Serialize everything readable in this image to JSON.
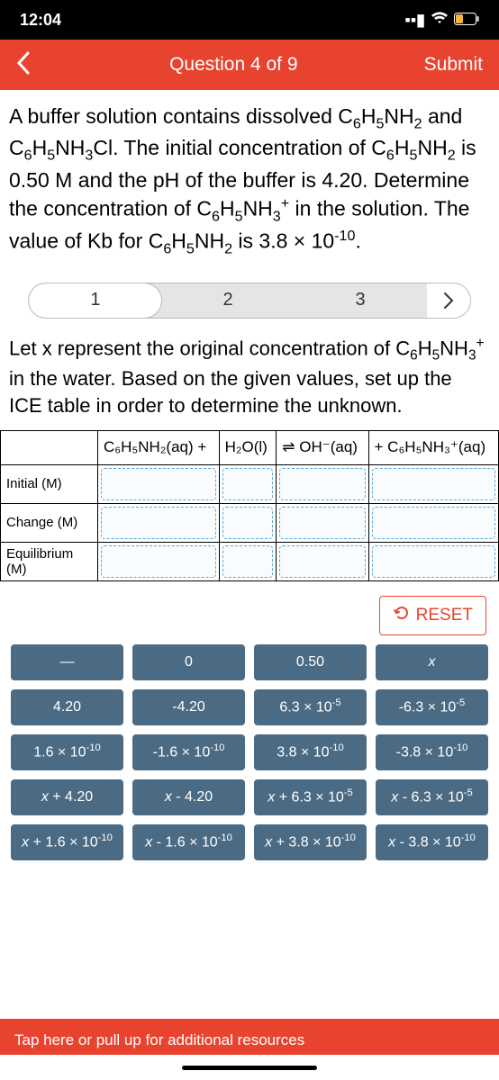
{
  "status": {
    "time": "12:04"
  },
  "header": {
    "title": "Question 4 of 9",
    "submit": "Submit"
  },
  "question_html": "A buffer solution contains dissolved C<sub>6</sub>H<sub>5</sub>NH<sub>2</sub> and C<sub>6</sub>H<sub>5</sub>NH<sub>3</sub>Cl. The initial concentration of C<sub>6</sub>H<sub>5</sub>NH<sub>2</sub> is 0.50 M and the pH of the buffer is 4.20. Determine the concentration of C<sub>6</sub>H<sub>5</sub>NH<sub>3</sub><sup>+</sup> in the solution. The value of Kb for C<sub>6</sub>H<sub>5</sub>NH<sub>2</sub> is 3.8 × 10<sup>-10</sup>.",
  "steps": {
    "s1": "1",
    "s2": "2",
    "s3": "3"
  },
  "instruction_html": "Let x represent the original concentration of C<sub>6</sub>H<sub>5</sub>NH<sub>3</sub><sup>+</sup> in the water. Based on the given values, set up the ICE table in order to determine the unknown.",
  "table": {
    "col1": "C₆H₅NH₂(aq)  +",
    "col2": "H₂O(l)",
    "col3": "⇌ OH⁻(aq)",
    "col4": "+ C₆H₅NH₃⁺(aq)",
    "r1": "Initial (M)",
    "r2": "Change (M)",
    "r3": "Equilibrium (M)"
  },
  "reset": "RESET",
  "options": [
    "—",
    "0",
    "0.50",
    "<i>x</i>",
    "4.20",
    "-4.20",
    "6.3 × 10<sup>-5</sup>",
    "-6.3 × 10<sup>-5</sup>",
    "1.6 × 10<sup>-10</sup>",
    "-1.6 × 10<sup>-10</sup>",
    "3.8 × 10<sup>-10</sup>",
    "-3.8 × 10<sup>-10</sup>",
    "<i>x</i> + 4.20",
    "<i>x</i> - 4.20",
    "<i>x</i> + 6.3 × 10<sup>-5</sup>",
    "<i>x</i> - 6.3 × 10<sup>-5</sup>",
    "<i>x</i> + 1.6 × 10<sup>-10</sup>",
    "<i>x</i> - 1.6 × 10<sup>-10</sup>",
    "<i>x</i> + 3.8 × 10<sup>-10</sup>",
    "<i>x</i> - 3.8 × 10<sup>-10</sup>"
  ],
  "footer": "Tap here or pull up for additional resources"
}
